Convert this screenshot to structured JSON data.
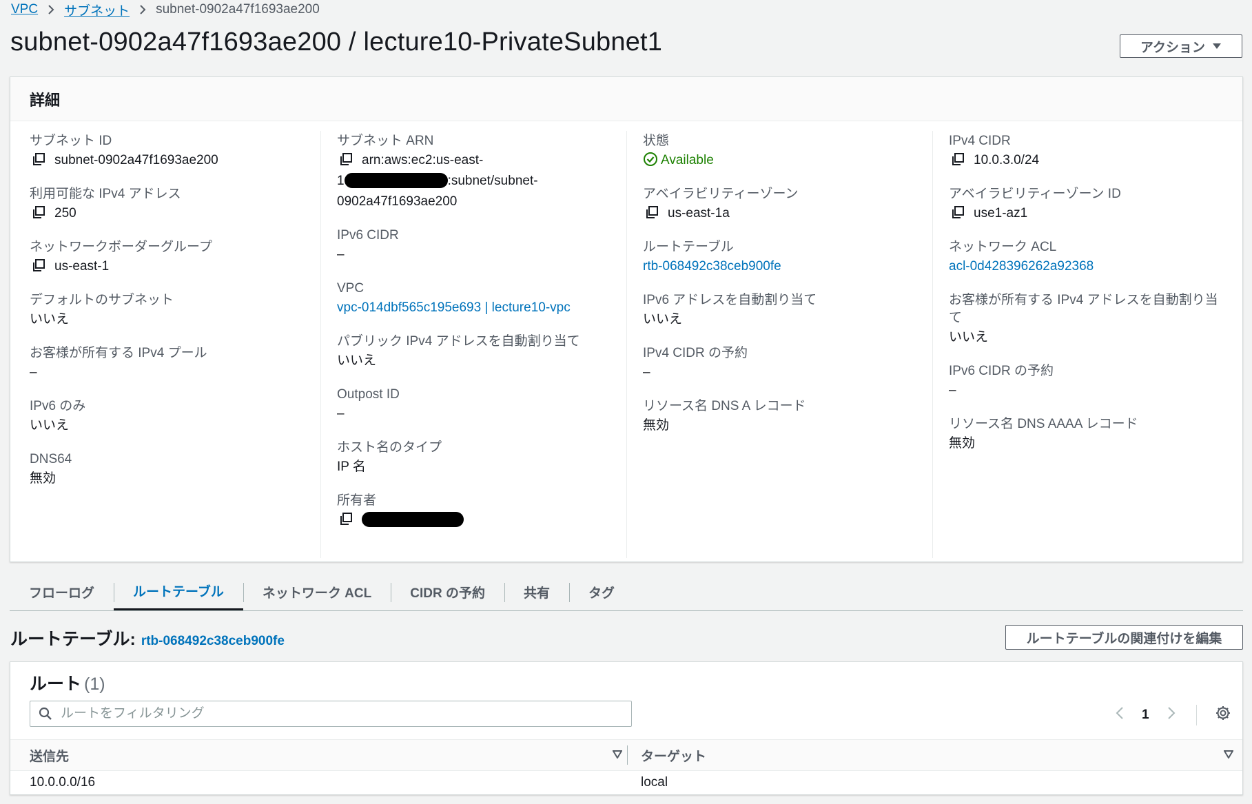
{
  "breadcrumb": {
    "items": [
      "VPC",
      "サブネット",
      "subnet-0902a47f1693ae200"
    ]
  },
  "page_title": "subnet-0902a47f1693ae200 / lecture10-PrivateSubnet1",
  "actions_label": "アクション",
  "details": {
    "title": "詳細",
    "col1": {
      "subnet_id_label": "サブネット ID",
      "subnet_id": "subnet-0902a47f1693ae200",
      "available_ipv4_label": "利用可能な IPv4 アドレス",
      "available_ipv4": "250",
      "nbg_label": "ネットワークボーダーグループ",
      "nbg": "us-east-1",
      "default_subnet_label": "デフォルトのサブネット",
      "default_subnet": "いいえ",
      "customer_ipv4_pool_label": "お客様が所有する IPv4 プール",
      "customer_ipv4_pool": "–",
      "ipv6_only_label": "IPv6 のみ",
      "ipv6_only": "いいえ",
      "dns64_label": "DNS64",
      "dns64": "無効"
    },
    "col2": {
      "arn_label": "サブネット ARN",
      "arn_line1": "arn:aws:ec2:us-east-",
      "arn_line2_prefix": "1",
      "arn_line2_suffix": ":subnet/subnet-",
      "arn_line3": "0902a47f1693ae200",
      "ipv6_cidr_label": "IPv6 CIDR",
      "ipv6_cidr": "–",
      "vpc_label": "VPC",
      "vpc": "vpc-014dbf565c195e693 | lecture10-vpc",
      "auto_public_ipv4_label": "パブリック IPv4 アドレスを自動割り当て",
      "auto_public_ipv4": "いいえ",
      "outpost_id_label": "Outpost ID",
      "outpost_id": "–",
      "hostname_type_label": "ホスト名のタイプ",
      "hostname_type": "IP 名",
      "owner_label": "所有者"
    },
    "col3": {
      "state_label": "状態",
      "state": "Available",
      "az_label": "アベイラビリティーゾーン",
      "az": "us-east-1a",
      "route_table_label": "ルートテーブル",
      "route_table": "rtb-068492c38ceb900fe",
      "auto_ipv6_label": "IPv6 アドレスを自動割り当て",
      "auto_ipv6": "いいえ",
      "ipv4_cidr_reservation_label": "IPv4 CIDR の予約",
      "ipv4_cidr_reservation": "–",
      "dns_a_label": "リソース名 DNS A レコード",
      "dns_a": "無効"
    },
    "col4": {
      "ipv4_cidr_label": "IPv4 CIDR",
      "ipv4_cidr": "10.0.3.0/24",
      "az_id_label": "アベイラビリティーゾーン ID",
      "az_id": "use1-az1",
      "nacl_label": "ネットワーク ACL",
      "nacl": "acl-0d428396262a92368",
      "customer_ipv4_auto_label": "お客様が所有する IPv4 アドレスを自動割り当て",
      "customer_ipv4_auto": "いいえ",
      "ipv6_cidr_reservation_label": "IPv6 CIDR の予約",
      "ipv6_cidr_reservation": "–",
      "dns_aaaa_label": "リソース名 DNS AAAA レコード",
      "dns_aaaa": "無効"
    }
  },
  "tabs": [
    "フローログ",
    "ルートテーブル",
    "ネットワーク ACL",
    "CIDR の予約",
    "共有",
    "タグ"
  ],
  "active_tab": "ルートテーブル",
  "route_table_section": {
    "title": "ルートテーブル:",
    "rtb_link": "rtb-068492c38ceb900fe",
    "edit_button": "ルートテーブルの関連付けを編集"
  },
  "routes": {
    "title": "ルート",
    "count": "(1)",
    "filter_placeholder": "ルートをフィルタリング",
    "page": "1",
    "columns": [
      "送信先",
      "ターゲット"
    ],
    "rows": [
      {
        "destination": "10.0.0.0/16",
        "target": "local"
      }
    ]
  },
  "colors": {
    "link": "#0073bb",
    "available": "#1d8102",
    "background": "#f2f3f3"
  }
}
